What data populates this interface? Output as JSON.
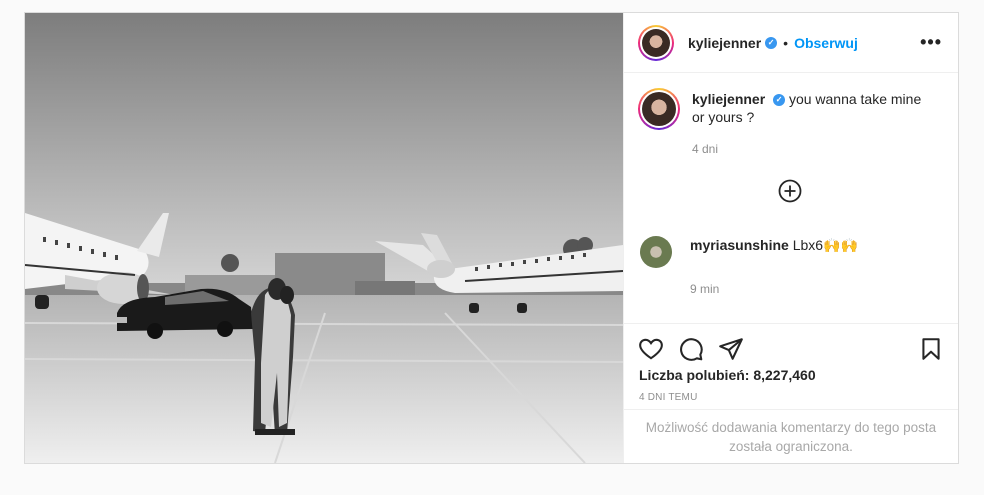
{
  "post": {
    "username": "kyliejenner",
    "verified_symbol": "✓",
    "separator": "•",
    "follow_label": "Obserwuj",
    "more_label": "•••"
  },
  "caption": {
    "username": "kyliejenner",
    "text": "you wanna take mine or yours ?",
    "time": "4 dni"
  },
  "comment": {
    "username": "myriasunshine",
    "text": "Lbx6🙌🙌",
    "time": "9 min"
  },
  "likes": {
    "label": "Liczba polubień: 8,227,460"
  },
  "posted_ago": "4 DNI TEMU",
  "comments_restricted": "Możliwość dodawania komentarzy do tego posta została ograniczona.",
  "colors": {
    "accent": "#0095f6",
    "verified": "#3897f0",
    "muted": "#8e8e8e",
    "border": "#dbdbdb"
  },
  "icons": [
    "heart-icon",
    "comment-icon",
    "share-icon",
    "bookmark-icon",
    "plus-circle-icon",
    "more-icon",
    "verified-icon"
  ]
}
